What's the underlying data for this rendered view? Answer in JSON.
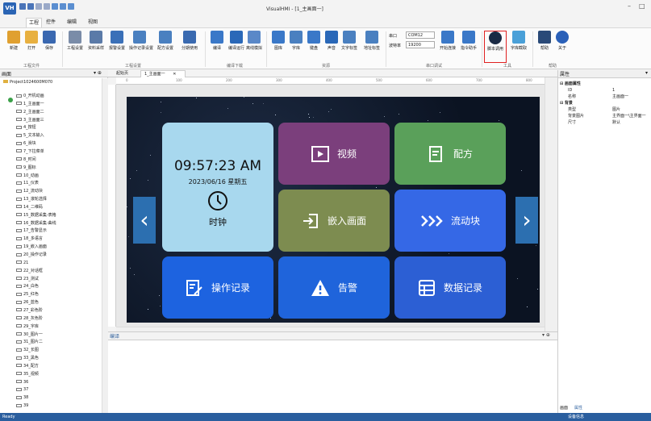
{
  "window": {
    "title": "VisualHMI - [1_主画面一]",
    "logo": "VH",
    "min_glyph": "–",
    "max_glyph": "□"
  },
  "menus": [
    "工程",
    "控件",
    "编辑",
    "视图"
  ],
  "ribbon": {
    "items": [
      "新建",
      "打开",
      "保存",
      "工程设置",
      "资料采样",
      "报警设置",
      "操作记录设置",
      "配方设置",
      "分期使用",
      "编译",
      "编译运行",
      "离线模拟",
      "量产下载",
      "图库",
      "字库",
      "键盘",
      "声音",
      "文字标签",
      "地址标签",
      "开始连接",
      "指令助手",
      "脚本调用",
      "字库截取",
      "帮助",
      "关于"
    ],
    "groups": [
      "工程文件",
      "工程设置",
      "编译下载",
      "资源",
      "串口调试",
      "工具",
      "帮助"
    ],
    "serial": {
      "port_label": "串口",
      "port_value": "COM12",
      "baud_label": "波特率",
      "baud_value": "19200"
    }
  },
  "left_panel": {
    "title": "画面",
    "pin": "▾ ⊕",
    "tree_root": "Project1024600M070",
    "screens": [
      "0_开机动画",
      "1_主画面一",
      "2_主画面二",
      "3_主画面三",
      "4_按钮",
      "5_文本输入",
      "6_滑块",
      "7_下拉菜单",
      "8_时间",
      "9_图标",
      "10_动画",
      "11_仪表",
      "12_流动块",
      "13_滚轮选择",
      "14_二维码",
      "15_数据采集-表格",
      "16_数据采集-曲线",
      "17_告警显示",
      "18_多语言",
      "19_嵌入画面",
      "20_操作记录",
      "21",
      "22_对话框",
      "23_测试",
      "24_白色",
      "25_红色",
      "26_蓝色",
      "27_彩色阶",
      "28_灰色阶",
      "29_字库",
      "30_图片一",
      "31_图片二",
      "32_长图",
      "33_黑色",
      "34_配方",
      "35_视频",
      "36",
      "37",
      "38",
      "39"
    ]
  },
  "tabs": [
    "起始页",
    "1_主画面一"
  ],
  "tab_close": "✕",
  "ruler_ticks": [
    "0",
    "100",
    "200",
    "300",
    "400",
    "500",
    "600",
    "700",
    "800"
  ],
  "hmi": {
    "time": "09:57:23 AM",
    "date": "2023/06/16 星期五",
    "clock_label": "时钟",
    "tiles": {
      "video": "视频",
      "recipe": "配方",
      "embed": "嵌入画面",
      "flow": "流动块",
      "oplog": "操作记录",
      "alarm": "告警",
      "datalog": "数据记录"
    },
    "prev": "‹",
    "next": "›",
    "colors": {
      "clock": "#a8d8ee",
      "video": "#7b3f7c",
      "recipe": "#5aa05a",
      "embed": "#7d8c50",
      "flow": "#3568e6",
      "oplog": "#1d63e0",
      "alarm": "#1f64db",
      "datalog": "#2c5fd4"
    }
  },
  "compile": {
    "title": "编译",
    "pin": "▾ ⊕"
  },
  "properties": {
    "title": "属性",
    "pin": "▾",
    "rows": [
      {
        "cat": "⊟ 画面属性"
      },
      {
        "k": "ID",
        "v": "1"
      },
      {
        "k": "名称",
        "v": "主画面一"
      },
      {
        "cat": "⊟ 背景"
      },
      {
        "k": "类型",
        "v": "图片"
      },
      {
        "k": "背景图片",
        "v": "主界面一\\主界面一"
      },
      {
        "k": "尺寸",
        "v": "默认"
      }
    ],
    "bottom_tabs": [
      "画面",
      "属性"
    ],
    "footer": "设备信息"
  },
  "status": "Ready"
}
